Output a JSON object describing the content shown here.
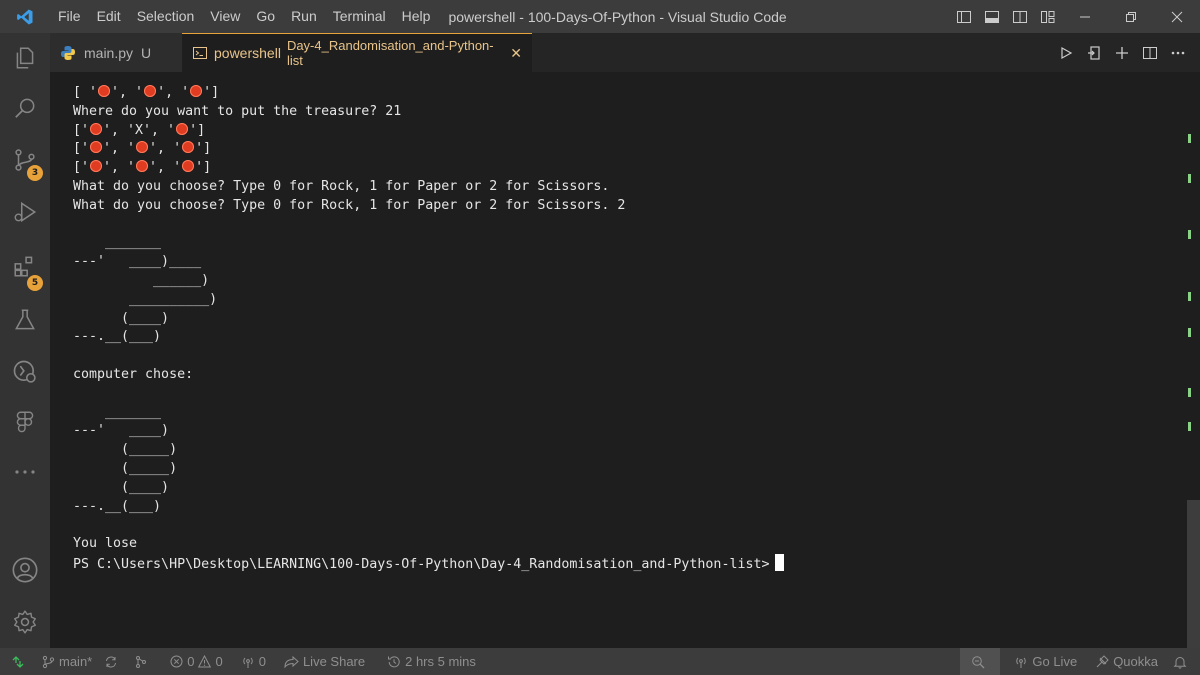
{
  "menu": [
    "File",
    "Edit",
    "Selection",
    "View",
    "Go",
    "Run",
    "Terminal",
    "Help"
  ],
  "window_title": "powershell - 100-Days-Of-Python - Visual Studio Code",
  "badges": {
    "source_control": "3",
    "extensions": "5"
  },
  "tabs": {
    "file_tab": {
      "name": "main.py",
      "status": "U"
    },
    "terminal_tab": {
      "name": "powershell",
      "folder": "Day-4_Randomisation_and-Python-list",
      "close": "✕"
    }
  },
  "terminal": {
    "lines": [
      {
        "parts": [
          "[ '",
          "DOT",
          "', '",
          "DOT",
          "', '",
          "DOT",
          "']"
        ]
      },
      {
        "text": "Where do you want to put the treasure? 21"
      },
      {
        "parts": [
          "['",
          "DOT",
          "', 'X', '",
          "DOT",
          "']"
        ]
      },
      {
        "parts": [
          "['",
          "DOT",
          "', '",
          "DOT",
          "', '",
          "DOT",
          "']"
        ]
      },
      {
        "parts": [
          "['",
          "DOT",
          "', '",
          "DOT",
          "', '",
          "DOT",
          "']"
        ]
      },
      {
        "text": "What do you choose? Type 0 for Rock, 1 for Paper or 2 for Scissors."
      },
      {
        "text": "What do you choose? Type 0 for Rock, 1 for Paper or 2 for Scissors. 2"
      },
      {
        "text": ""
      },
      {
        "text": "    _______"
      },
      {
        "text": "---'   ____)____"
      },
      {
        "text": "          ______)"
      },
      {
        "text": "       __________)"
      },
      {
        "text": "      (____)"
      },
      {
        "text": "---.__(___)"
      },
      {
        "text": ""
      },
      {
        "text": "computer chose:"
      },
      {
        "text": ""
      },
      {
        "text": "    _______"
      },
      {
        "text": "---'   ____)"
      },
      {
        "text": "      (_____)"
      },
      {
        "text": "      (_____)"
      },
      {
        "text": "      (____)"
      },
      {
        "text": "---.__(___)"
      },
      {
        "text": ""
      },
      {
        "text": "You lose"
      },
      {
        "text": "PS C:\\Users\\HP\\Desktop\\LEARNING\\100-Days-Of-Python\\Day-4_Randomisation_and-Python-list>",
        "cursor": true
      }
    ]
  },
  "status": {
    "branch": "main*",
    "errors": "0",
    "warnings": "0",
    "ports": "0",
    "live_share": "Live Share",
    "time_tracker": "2 hrs 5 mins",
    "go_live": "Go Live",
    "quokka": "Quokka"
  },
  "colors": {
    "accent": "#e8a23a",
    "status_green": "#3dbb5c",
    "terminal_bg": "#1e1e1e",
    "dot_red": "#e03c22"
  }
}
